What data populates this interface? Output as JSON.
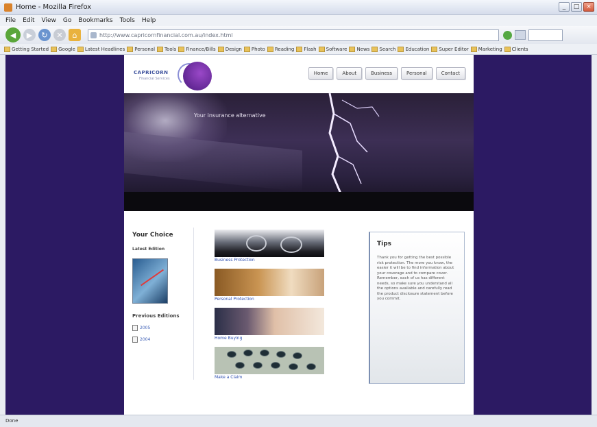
{
  "window": {
    "title": "Home - Mozilla Firefox"
  },
  "menu": [
    "File",
    "Edit",
    "View",
    "Go",
    "Bookmarks",
    "Tools",
    "Help"
  ],
  "address": {
    "url": "http://www.capricornfinancial.com.au/index.html"
  },
  "bookmarks": [
    "Getting Started",
    "Google",
    "Latest Headlines",
    "Personal",
    "Tools",
    "Finance/Bills",
    "Design",
    "Photo",
    "Reading",
    "Flash",
    "Software",
    "News",
    "Search",
    "Education",
    "Super Editor",
    "Marketing",
    "Clients"
  ],
  "site": {
    "logo_text": "CAPRICORN",
    "logo_sub": "Financial Services",
    "nav": [
      "Home",
      "About",
      "Business",
      "Personal",
      "Contact"
    ],
    "hero_text": "Your insurance alternative",
    "sidebar": {
      "title": "Your Choice",
      "subtitle": "Latest Edition",
      "previous": "Previous Editions",
      "links": [
        "2005",
        "2004"
      ]
    },
    "products": [
      {
        "label": "Business Protection"
      },
      {
        "label": "Personal Protection"
      },
      {
        "label": "Home Buying"
      },
      {
        "label": "Make a Claim"
      }
    ],
    "tips": {
      "title": "Tips",
      "text": "Thank you for getting the best possible risk protection. The more you know, the easier it will be to find information about your coverage and to compare cover. Remember, each of us has different needs, so make sure you understand all the options available and carefully read the product disclosure statement before you commit."
    }
  },
  "status": {
    "text": "Done"
  }
}
